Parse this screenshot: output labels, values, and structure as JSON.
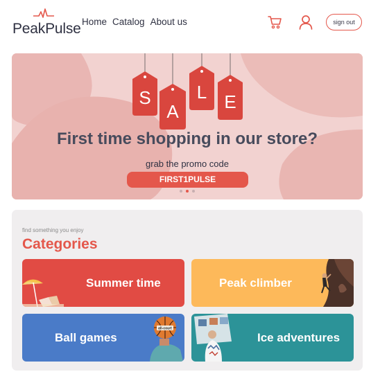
{
  "brand": {
    "name": "PeakPulse"
  },
  "nav": {
    "items": [
      "Home",
      "Catalog",
      "About us"
    ]
  },
  "header": {
    "signout_label": "sign out",
    "cart_icon": "cart-icon",
    "user_icon": "user-icon"
  },
  "banner": {
    "tag_letters": [
      "S",
      "A",
      "L",
      "E"
    ],
    "headline": "First time shopping in our store?",
    "subtext": "grab the promo code",
    "promo_code": "FIRST1PULSE",
    "slide_count": 3,
    "active_slide": 2
  },
  "categories": {
    "eyebrow": "find something you enjoy",
    "title": "Categories",
    "items": [
      {
        "label": "Summer time",
        "color": "#e14b44"
      },
      {
        "label": "Peak climber",
        "color": "#fdb95a"
      },
      {
        "label": "Ball games",
        "color": "#4a7bc8"
      },
      {
        "label": "Ice adventures",
        "color": "#2c9398"
      }
    ]
  },
  "colors": {
    "accent": "#e4574b",
    "banner_bg": "#f2d2d0",
    "panel_bg": "#f0eeef",
    "text": "#2f3142"
  }
}
